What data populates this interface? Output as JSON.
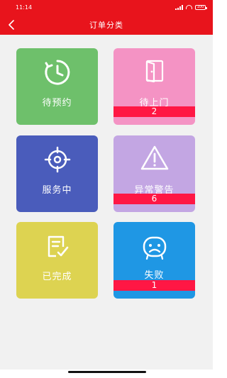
{
  "status_bar": {
    "time": "11:14",
    "battery": "100"
  },
  "nav": {
    "title": "订单分类"
  },
  "cards": [
    {
      "label": "待预约",
      "badge": null,
      "color": "#6ec06b",
      "icon": "clock-icon"
    },
    {
      "label": "待上门",
      "badge": "2",
      "color": "#f493c4",
      "icon": "door-icon"
    },
    {
      "label": "服务中",
      "badge": null,
      "color": "#4a5cbb",
      "icon": "target-icon"
    },
    {
      "label": "异常警告",
      "badge": "6",
      "color": "#c3a6e3",
      "icon": "warning-icon"
    },
    {
      "label": "已完成",
      "badge": null,
      "color": "#ddd351",
      "icon": "checklist-icon"
    },
    {
      "label": "失败",
      "badge": "1",
      "color": "#1f97e4",
      "icon": "sad-face-icon"
    }
  ],
  "colors": {
    "primary": "#e8141c",
    "badge": "#ff1744",
    "background": "#f1f1f1"
  }
}
